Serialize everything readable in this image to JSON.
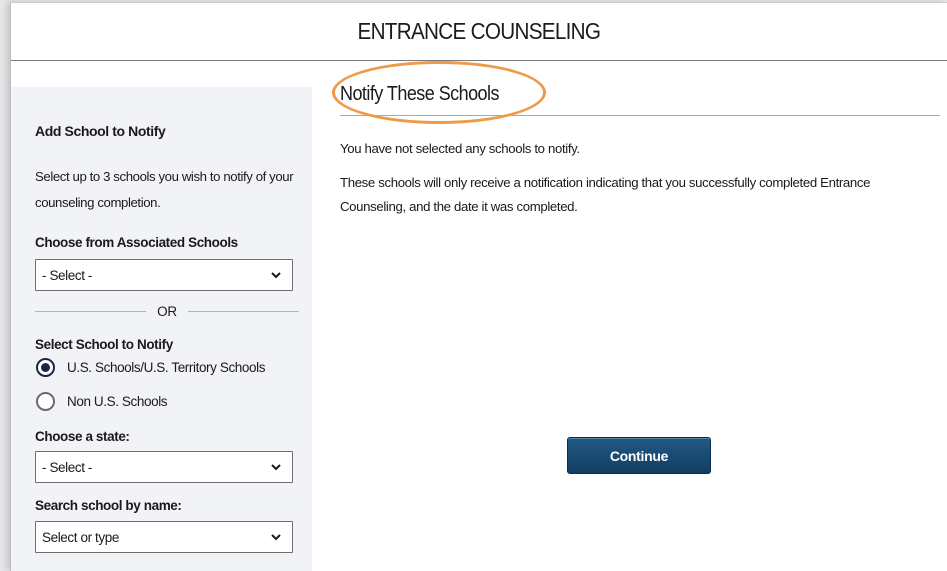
{
  "header": {
    "title": "ENTRANCE COUNSELING"
  },
  "sidebar": {
    "title": "Add School to Notify",
    "description": "Select up to 3 schools you wish to notify of your counseling completion.",
    "associated_label": "Choose from Associated Schools",
    "associated_select_value": "- Select -",
    "or_text": "OR",
    "school_type_label": "Select School to Notify",
    "radio_options": [
      {
        "label": "U.S. Schools/U.S. Territory Schools",
        "checked": true
      },
      {
        "label": "Non U.S. Schools",
        "checked": false
      }
    ],
    "state_label": "Choose a state:",
    "state_select_value": "- Select -",
    "search_label": "Search school by name:",
    "search_select_value": "Select or type"
  },
  "main": {
    "title": "Notify These Schools",
    "empty_message": "You have not selected any schools to notify.",
    "info_text": "These schools will only receive a notification indicating that you successfully completed Entrance Counseling, and the date it was completed.",
    "continue_label": "Continue"
  },
  "colors": {
    "highlight_circle": "#ee9a49",
    "button": "#1a4f7a",
    "sidebar_bg": "#f1f3f7",
    "radio_selected": "#1a2744"
  },
  "icons": [
    "chevron-down-icon"
  ]
}
